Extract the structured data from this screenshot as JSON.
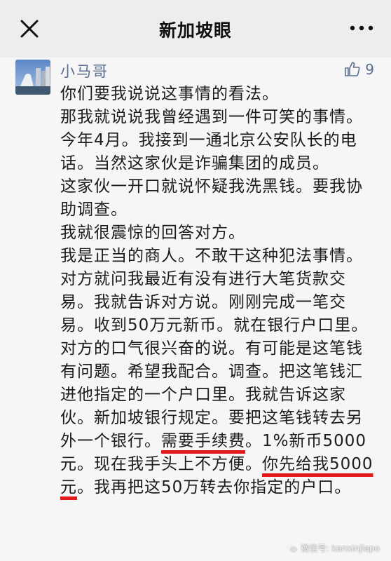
{
  "header": {
    "title": "新加坡眼",
    "close_icon": "close-icon",
    "more_icon": "more-icon"
  },
  "comment": {
    "username": "小马哥",
    "like_count": "9",
    "paragraphs": [
      [
        "你们要我说说这事情的看法。"
      ],
      [
        "那我就说说我曾经遇到一件可笑的事情。"
      ],
      [
        "今年4月。我接到一通北京公安队长的电话。当然这家伙是诈骗集团的成员。"
      ],
      [
        "这家伙一开口就说怀疑我洗黑钱。要我协助调查。"
      ],
      [
        "我就很震惊的回答对方。"
      ],
      [
        "我是正当的商人。不敢干这种犯法事情。对方就问我最近有没有进行大笔货款交易。我就告诉对方说。刚刚完成一笔交易。收到50万元新币。就在银行户口里。"
      ],
      [
        "对方的口气很兴奋的说。有可能是这笔钱有问题。希望我配合。调查。把这笔钱汇进他指定的一个户口里。我就告诉这家伙。新加坡银行规定。要把这笔钱转去另外一个银行。",
        "需要手续费",
        "。1%新币5000元。现在我手头上不方便。",
        "你先给我5000元",
        "。我再把这50万转去你指定的户口。"
      ]
    ]
  },
  "watermark": {
    "text": "微信号: kanxinjiapo"
  },
  "colors": {
    "accent_name": "#5d6f8f",
    "highlight_underline": "#e31b1b"
  }
}
